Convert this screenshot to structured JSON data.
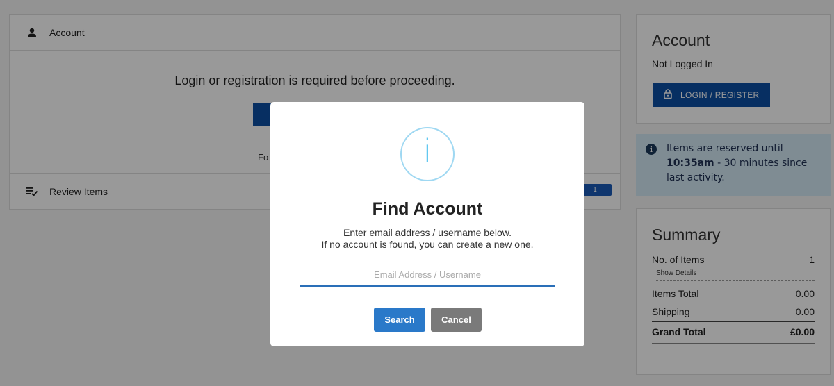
{
  "main": {
    "account_section": {
      "title": "Account",
      "icon": "person-icon"
    },
    "login_message": "Login or registration is required before proceeding.",
    "partial_text": "Fo",
    "review_section": {
      "title": "Review Items",
      "icon": "checklist-icon",
      "count": "1"
    }
  },
  "sidebar": {
    "account_card": {
      "title": "Account",
      "status": "Not Logged In",
      "login_button": "LOGIN / REGISTER",
      "login_icon": "lock-icon"
    },
    "notice": {
      "icon": "info-icon",
      "prefix": "Items are reserved until",
      "time": "10:35am",
      "suffix": "- 30 minutes since last activity."
    },
    "summary": {
      "title": "Summary",
      "items_label": "No. of Items",
      "items_value": "1",
      "show_details": "Show Details",
      "items_total_label": "Items Total",
      "items_total_value": "0.00",
      "shipping_label": "Shipping",
      "shipping_value": "0.00",
      "grand_total_label": "Grand Total",
      "grand_total_value": "£0.00"
    }
  },
  "modal": {
    "icon": "info-circle-icon",
    "icon_glyph": "i",
    "title": "Find Account",
    "desc_line1": "Enter email address / username below.",
    "desc_line2": "If no account is found, you can create a new one.",
    "input_placeholder": "Email Address / Username",
    "input_value": "",
    "search_button": "Search",
    "cancel_button": "Cancel"
  },
  "colors": {
    "primary": "#0d4fa3",
    "search": "#2a79c9",
    "cancel": "#7a7a7a",
    "info": "#4cc0ee",
    "notice_bg": "#d4eaf6"
  }
}
